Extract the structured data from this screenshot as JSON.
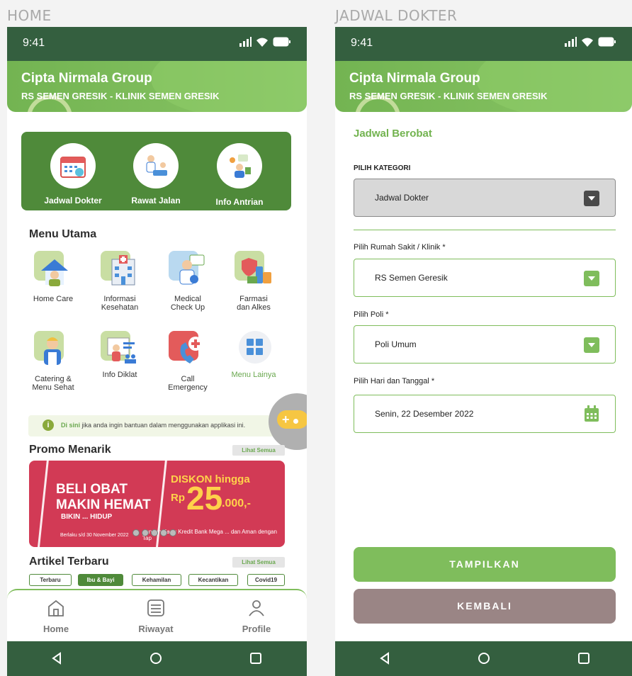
{
  "screens": {
    "home_title": "HOME",
    "jadwal_title": "JADWAL DOKTER"
  },
  "status": {
    "time": "9:41"
  },
  "header": {
    "title": "Cipta Nirmala Group",
    "subtitle": "RS SEMEN GRESIK - KLINIK SEMEN GRESIK"
  },
  "home": {
    "quick": [
      {
        "label": "Jadwal Dokter",
        "icon": "calendar-icon"
      },
      {
        "label": "Rawat Jalan",
        "icon": "doctor-patient-icon"
      },
      {
        "label": "Info Antrian",
        "icon": "queue-info-icon"
      }
    ],
    "menu_title": "Menu Utama",
    "menu": [
      {
        "line1": "Home Care",
        "line2": "",
        "icon": "home-care-icon"
      },
      {
        "line1": "Informasi",
        "line2": "Kesehatan",
        "icon": "hospital-icon"
      },
      {
        "line1": "Medical",
        "line2": "Check Up",
        "icon": "medical-checkup-icon"
      },
      {
        "line1": "Farmasi",
        "line2": "dan Alkes",
        "icon": "pharmacy-icon"
      },
      {
        "line1": "Catering &",
        "line2": "Menu Sehat",
        "icon": "catering-icon"
      },
      {
        "line1": "Info Diklat",
        "line2": "",
        "icon": "training-icon"
      },
      {
        "line1": "Call",
        "line2": "Emergency",
        "icon": "emergency-call-icon"
      },
      {
        "line1": "Menu Lainya",
        "line2": "",
        "icon": "grid-menu-icon"
      }
    ],
    "help": {
      "link": "Di sini",
      "text": " jika anda ingin bantuan dalam menggunakan applikasi ini."
    },
    "promo_title": "Promo Menarik",
    "see_all": "Lihat Semua",
    "promo": {
      "line1": "BELI OBAT",
      "line2": "MAKIN HEMAT",
      "line3": "BIKIN ... HIDUP",
      "discount": "DISKON hingga",
      "currency": "Rp",
      "amount": "25",
      "suffix": ".000,-",
      "valid": "Berlaku s/d 30 November 2022",
      "card_note": "dengan Kartu Kredit Bank Mega ... dan Aman dengan Tap"
    },
    "article_title": "Artikel Terbaru",
    "tags": [
      "Terbaru",
      "Ibu & Bayi",
      "Kehamilan",
      "Kecantikan",
      "Covid19"
    ],
    "nav": [
      {
        "label": "Home",
        "icon": "home-icon"
      },
      {
        "label": "Riwayat",
        "icon": "history-icon"
      },
      {
        "label": "Profile",
        "icon": "profile-icon"
      }
    ]
  },
  "jadwal": {
    "form_title": "Jadwal Berobat",
    "category_label": "PILIH KATEGORI",
    "category_value": "Jadwal Dokter",
    "hospital_label": "Pilih Rumah Sakit / Klinik *",
    "hospital_value": "RS Semen Geresik",
    "poli_label": "Pilih Poli *",
    "poli_value": "Poli Umum",
    "date_label": "Pilih Hari dan Tanggal *",
    "date_value": "Senin, 22 Desember 2022",
    "show_button": "TAMPILKAN",
    "back_button": "KEMBALI"
  },
  "colors": {
    "dark_green": "#345f3f",
    "green": "#7fbd5c",
    "card_green": "#4f8a3a",
    "back_button": "#9a8585",
    "promo_red": "#d23a55"
  }
}
